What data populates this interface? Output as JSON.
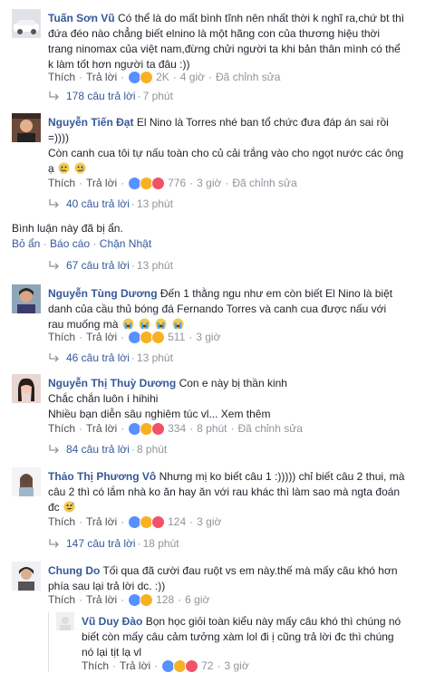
{
  "actions": {
    "like": "Thích",
    "reply": "Trả lời",
    "edited": "Đã chỉnh sửa",
    "sep": "·"
  },
  "comments": [
    {
      "name": "Tuấn Sơn Vũ",
      "text_lines": [
        "Có thể là do mất bình tĩnh nên nhất thời k nghĩ ra,chứ bt thì",
        "đứa đéo nào chẳng biết elnino là một hãng con của thương hiệu thời",
        "trang ninomax của việt nam,đừng chửi người ta khi bản thân mình có thể",
        "k làm tốt hơn người ta đâu :))"
      ],
      "reactions": [
        "like",
        "haha"
      ],
      "count": "2K",
      "time": "4 giờ",
      "replies": "178 câu trả lời",
      "replies_time": "7 phút"
    },
    {
      "name": "Nguyễn Tiến Đạt",
      "text_lines": [
        "El Nino là Torres nhé  ban tổ chức đưa đáp án sai rồi",
        "=))))",
        "Còn canh cua tôi tự nấu toàn cho củ cải trắng vào cho ngọt nước các ông",
        "ạ"
      ],
      "reactions": [
        "like",
        "haha",
        "heart"
      ],
      "count": "776",
      "time": "3 giờ",
      "replies": "40 câu trả lời",
      "replies_time": "13 phút"
    },
    {
      "hidden_text": "Bình luận này đã bị ẩn.",
      "hidden_actions": [
        "Bỏ ẩn",
        "Báo cáo",
        "Chặn Nhật"
      ],
      "replies": "67 câu trả lời",
      "replies_time": "13 phút"
    },
    {
      "name": "Nguyễn Tùng Dương",
      "text_lines": [
        "Đến 1 thằng ngu như em còn biết El Nino là biệt",
        "danh của cầu thủ bóng đá Fernando Torres và canh cua được nấu với",
        "rau muống mà"
      ],
      "reactions": [
        "like",
        "haha",
        "sad"
      ],
      "count": "511",
      "time": "3 giờ",
      "replies": "46 câu trả lời",
      "replies_time": "13 phút"
    },
    {
      "name": "Nguyễn Thị Thuỳ Dương",
      "text_lines": [
        "Con e này bị thần kinh",
        "Chắc chắn luôn í hihihi",
        "Nhiều bạn diễn sâu nghiêm túc vl... Xem thêm"
      ],
      "reactions": [
        "like",
        "haha",
        "heart"
      ],
      "count": "334",
      "time": "8 phút",
      "replies": "84 câu trả lời",
      "replies_time": "8 phút"
    },
    {
      "name": "Thảo Thị Phương Vô",
      "text_lines": [
        "Nhưng mị ko biết câu 1 :))))) chỉ biết câu 2 thui, mà",
        "câu 2 thì có lắm nhà ko ăn hay ăn với rau khác thì làm sao mà ngta đoán",
        "đc"
      ],
      "reactions": [
        "like",
        "haha",
        "heart"
      ],
      "count": "124",
      "time": "3 giờ",
      "replies": "147 câu trả lời",
      "replies_time": "18 phút"
    },
    {
      "name": "Chung Do",
      "text_lines": [
        "Tối qua đã cười đau ruột vs em này.thế mà mấy câu khó hơn",
        "phía sau lại trả lời dc. :))"
      ],
      "reactions": [
        "like",
        "haha"
      ],
      "count": "128",
      "time": "6 giờ"
    },
    {
      "name": "Vũ Duy Đào",
      "text_lines": [
        "Bọn học giỏi toàn kiểu này mấy câu khó thì chúng nó",
        "biết còn mấy câu cảm tưởng xàm lol đi ị cũng trả lời đc thì chúng",
        "nó lại tịt lạ vl"
      ],
      "reactions": [
        "like",
        "haha",
        "heart"
      ],
      "count": "72",
      "time": "3 giờ"
    }
  ]
}
